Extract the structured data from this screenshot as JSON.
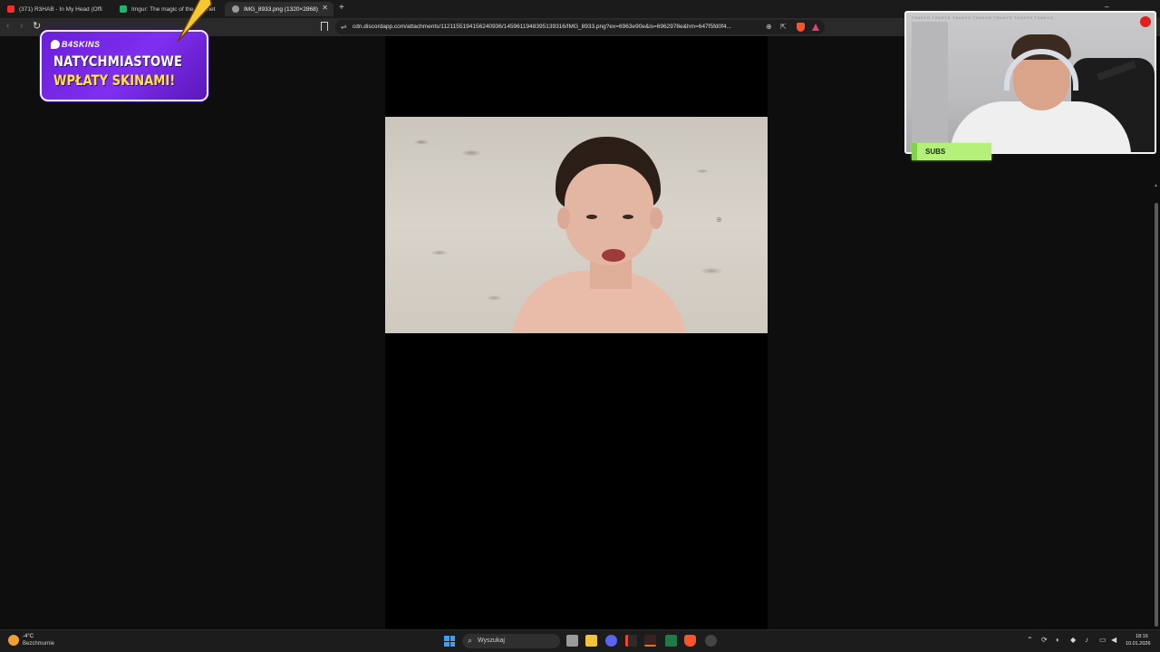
{
  "browser": {
    "tabs": [
      {
        "label": "(371) R3HAB - In My Head (Offi",
        "favicon_color": "#ff2a2a"
      },
      {
        "label": "Imgur: The magic of the Internet",
        "favicon_color": "#1bb76e"
      },
      {
        "label": "IMG_8933.png (1320×2868)",
        "favicon_color": "#9a9a9a"
      }
    ],
    "new_tab_label": "+",
    "url": "cdn.discordapp.com/attachments/1121155194156240936/1459611948395139316/IMG_8933.png?ex=6963e90e&is=6962978e&hm=647f5fd0f4..."
  },
  "overlays": {
    "promo_brand": "B4SKINS",
    "promo_line1": "NATYCHMIASTOWE",
    "promo_line2": "WPŁATY SKINAMI!",
    "subs_label": "SUBS",
    "webcam_brand_text": "TOUKYO TOUKYO TOUKYO TOUKYO TOUKYO TOUKYO TOUKYO"
  },
  "taskbar": {
    "weather_temp": "-4°C",
    "weather_condition": "Bezchmurnie",
    "search_placeholder": "Wyszukaj",
    "clock_time": "18:16",
    "clock_date": "10.01.2026"
  },
  "colors": {
    "promo_bg": "#7f2ff0",
    "promo_accent": "#ffe23a",
    "subs_badge": "#b4f07a",
    "brave_shield": "#fb542b"
  }
}
